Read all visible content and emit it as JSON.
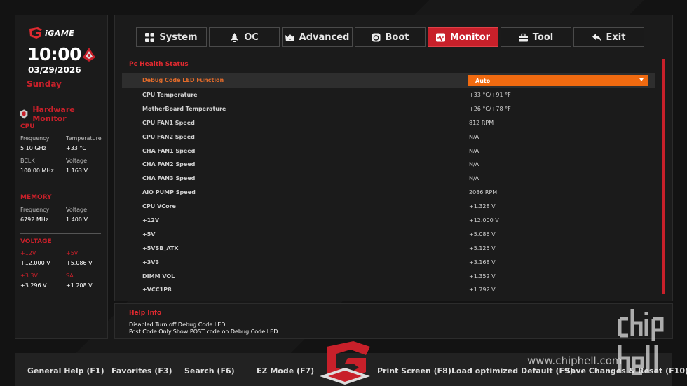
{
  "brand": {
    "logo_text": "iGAME"
  },
  "clock": {
    "time": "10:00",
    "date": "03/29/2026",
    "weekday": "Sunday"
  },
  "hardware_monitor": {
    "title": "Hardware Monitor",
    "cpu": {
      "heading": "CPU",
      "frequency_label": "Frequency",
      "frequency_value": "5.10 GHz",
      "temperature_label": "Temperature",
      "temperature_value": "+33 °C",
      "bclk_label": "BCLK",
      "bclk_value": "100.00 MHz",
      "voltage_label": "Voltage",
      "voltage_value": "1.163 V"
    },
    "memory": {
      "heading": "MEMORY",
      "frequency_label": "Frequency",
      "frequency_value": "6792 MHz",
      "voltage_label": "Voltage",
      "voltage_value": "1.400 V"
    },
    "voltage": {
      "heading": "VOLTAGE",
      "v12_label": "+12V",
      "v12_value": "+12.000 V",
      "v5_label": "+5V",
      "v5_value": "+5.086 V",
      "v33_label": "+3.3V",
      "v33_value": "+3.296 V",
      "sa_label": "SA",
      "sa_value": "+1.208 V"
    }
  },
  "tabs": [
    {
      "label": "System",
      "icon": "grid-icon"
    },
    {
      "label": "OC",
      "icon": "rocket-icon"
    },
    {
      "label": "Advanced",
      "icon": "crown-icon"
    },
    {
      "label": "Boot",
      "icon": "power-icon"
    },
    {
      "label": "Monitor",
      "icon": "monitor-icon",
      "active": true
    },
    {
      "label": "Tool",
      "icon": "toolbox-icon"
    },
    {
      "label": "Exit",
      "icon": "back-arrow-icon"
    }
  ],
  "main": {
    "section_title": "Pc Health Status",
    "debug_row": {
      "label": "Debug Code LED Function",
      "value": "Auto"
    },
    "rows": [
      {
        "label": "CPU  Temperature",
        "value": "+33 °C/+91 °F"
      },
      {
        "label": "MotherBoard  Temperature",
        "value": "+26 °C/+78 °F"
      },
      {
        "label": "CPU FAN1 Speed",
        "value": "812 RPM"
      },
      {
        "label": "CPU FAN2 Speed",
        "value": "N/A"
      },
      {
        "label": "CHA FAN1 Speed",
        "value": "N/A"
      },
      {
        "label": "CHA FAN2 Speed",
        "value": "N/A"
      },
      {
        "label": "CHA FAN3 Speed",
        "value": "N/A"
      },
      {
        "label": "AIO PUMP Speed",
        "value": "2086 RPM"
      },
      {
        "label": "CPU VCore",
        "value": "+1.328 V"
      },
      {
        "label": "+12V",
        "value": "+12.000 V"
      },
      {
        "label": "+5V",
        "value": "+5.086 V"
      },
      {
        "label": "+5VSB_ATX",
        "value": "+5.125 V"
      },
      {
        "label": "+3V3",
        "value": "+3.168 V"
      },
      {
        "label": "DIMM VOL",
        "value": "+1.352 V"
      },
      {
        "label": "+VCC1P8",
        "value": "+1.792 V"
      }
    ]
  },
  "help": {
    "title": "Help Info",
    "line1": "Disabled:Turn off Debug Code LED.",
    "line2": "Post Code Only:Show POST code on Debug Code LED."
  },
  "bottom_bar": {
    "general_help": "General Help (F1)",
    "favorites": "Favorites (F3)",
    "search": "Search (F6)",
    "ez_mode": "EZ Mode (F7)",
    "print_screen": "Print Screen (F8)",
    "load_defaults": "Load optimized Default (F9)",
    "save_reset": "Save Changes & Reset (F10)"
  },
  "watermark": {
    "text": "www.chiphell.com"
  },
  "colors": {
    "accent": "#c8202a",
    "dropdown": "#f06a10",
    "panel": "#1b1b1b"
  }
}
